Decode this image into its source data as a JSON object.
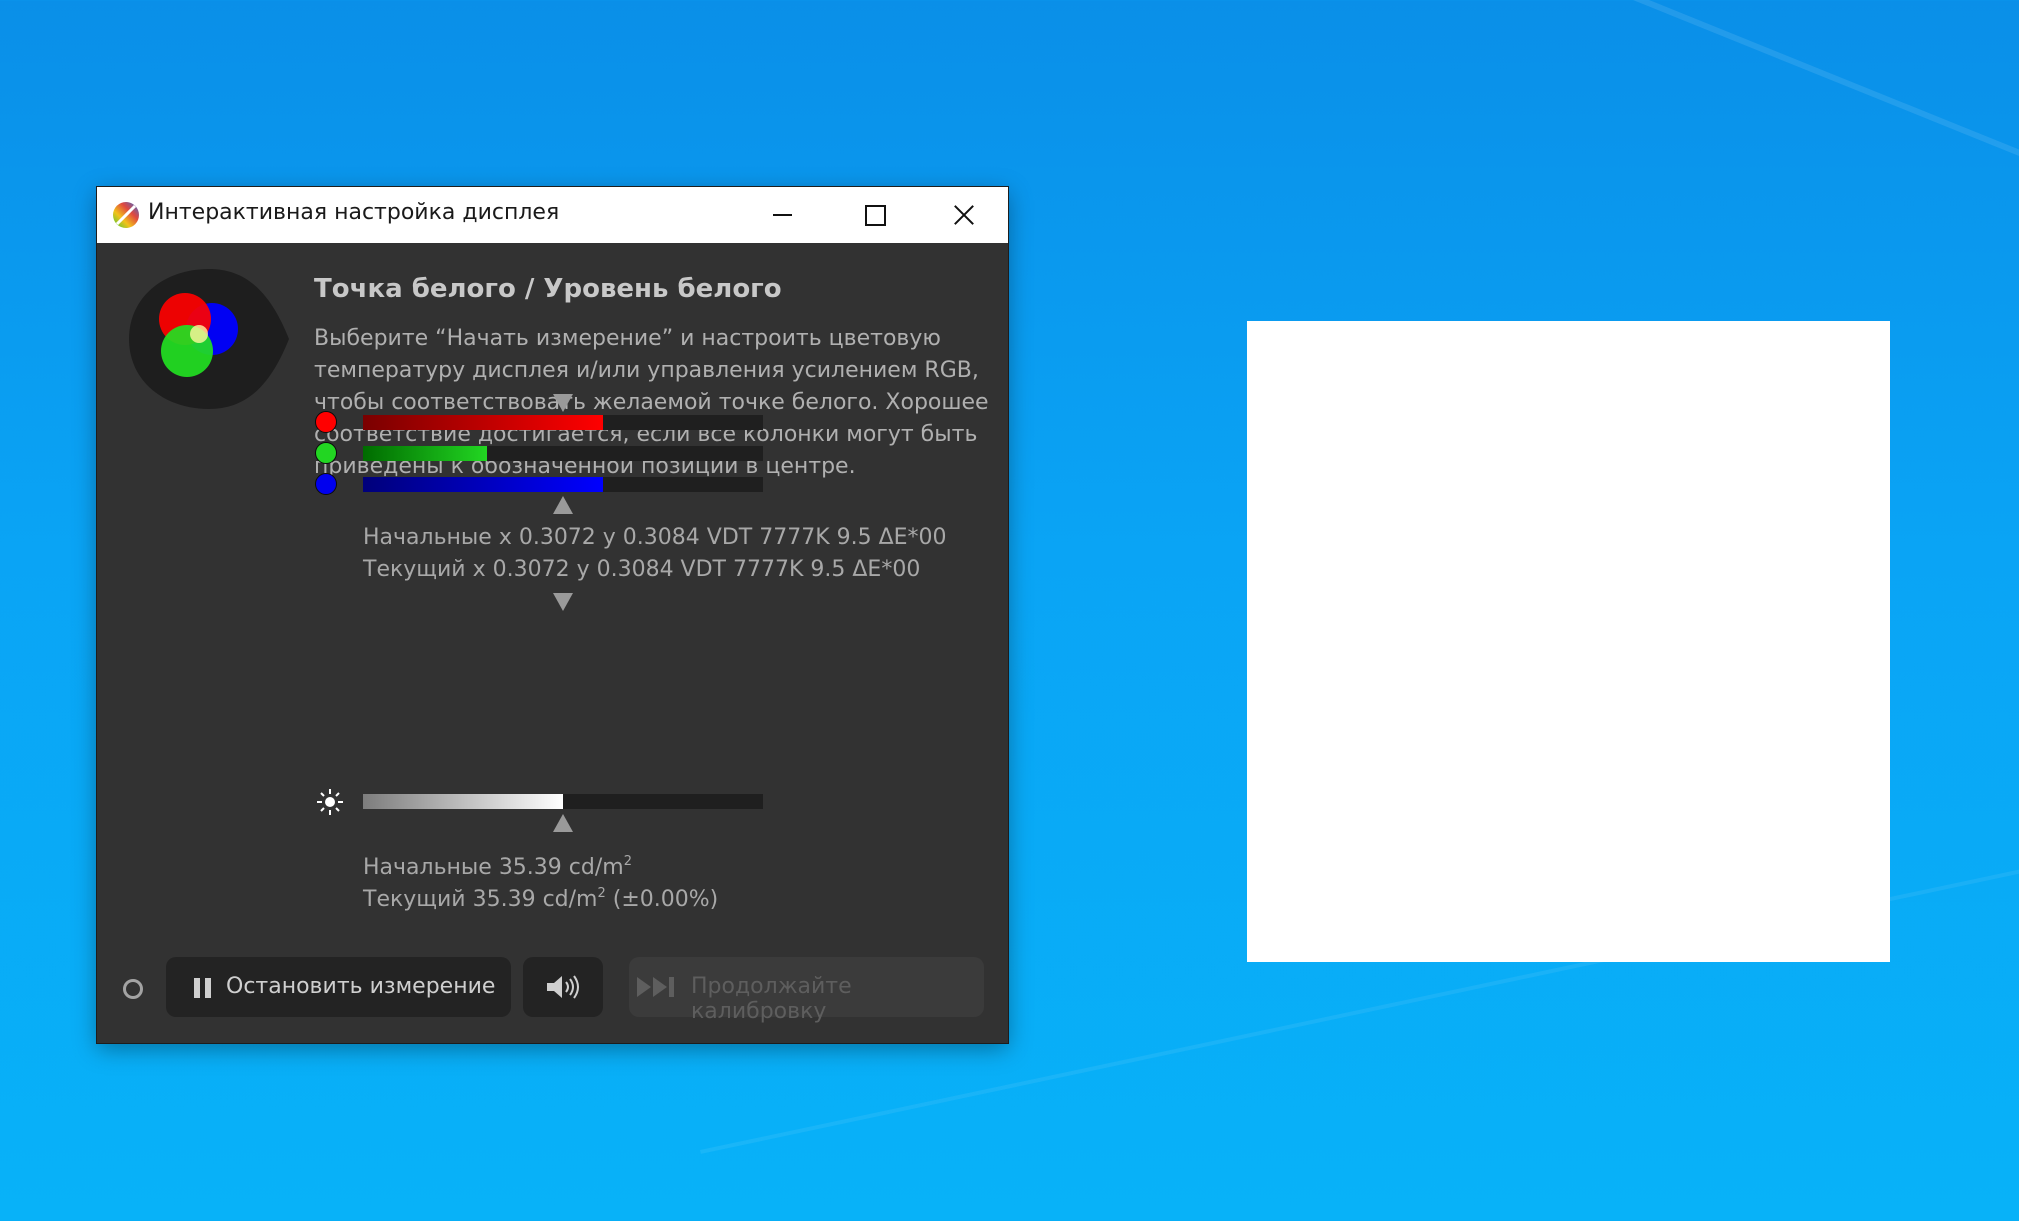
{
  "window": {
    "title": "Интерактивная настройка дисплея",
    "controls": [
      "minimize",
      "maximize",
      "close"
    ]
  },
  "heading": "Точка белого / Уровень белого",
  "description": "Выберите “Начать измерение” и настроить цветовую температуру дисплея и/или управления усилением RGB, чтобы соответствовать желаемой точке белого. Хорошее соответствие достигается, если все колонки могут быть приведены к обозначенной позиции в центре.",
  "rgb_bars": [
    {
      "channel": "red",
      "level": 0.6,
      "dot_color": "#ff0000",
      "fill_from": "#7a0000",
      "fill_to": "#ff0000"
    },
    {
      "channel": "green",
      "level": 0.31,
      "dot_color": "#22d622",
      "fill_from": "#006b00",
      "fill_to": "#22d622"
    },
    {
      "channel": "blue",
      "level": 0.6,
      "dot_color": "#0000ee",
      "fill_from": "#00007a",
      "fill_to": "#0000ff"
    }
  ],
  "rgb_target": 0.5,
  "chroma": {
    "initial": "Начальные x 0.3072 y 0.3084 VDT 7777K 9.5 ΔE*00",
    "current": "Текущий x 0.3072 y 0.3084 VDT 7777K 9.5 ΔE*00"
  },
  "luminance": {
    "level": 0.5,
    "target": 0.5,
    "initial_label": "Начальные 35.39 cd/m",
    "current_label": "Текущий 35.39 cd/m",
    "current_suffix": " (±0.00%)",
    "unit_exp": "2"
  },
  "buttons": {
    "stop_label": "Остановить измерение",
    "continue_label": "Продолжайте калибровку"
  },
  "icons": {
    "app": "displaycal-icon",
    "status": "status-dot-icon",
    "pause": "pause-icon",
    "sound": "speaker-icon",
    "skip": "skip-forward-icon",
    "brightness": "sun-icon"
  },
  "colors": {
    "window_bg": "#323232",
    "desktop": "#0aa4f5",
    "patch": "#ffffff"
  }
}
